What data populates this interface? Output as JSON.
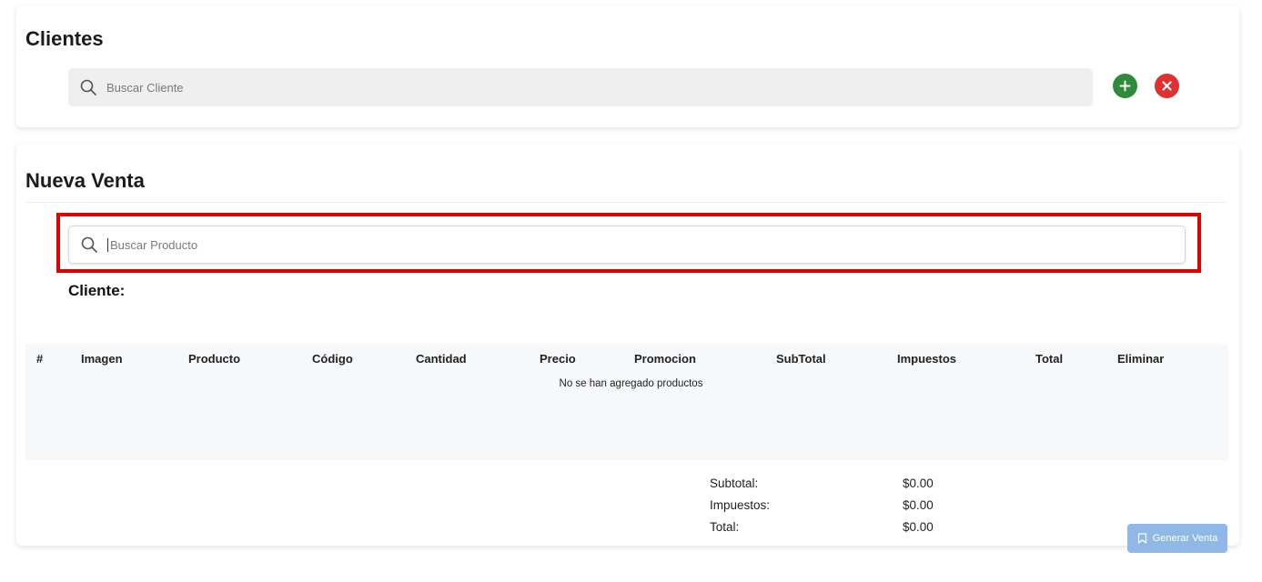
{
  "clientes": {
    "title": "Clientes",
    "search_placeholder": "Buscar Cliente",
    "add_color": "#2e8b3a",
    "remove_color": "#e03030"
  },
  "venta": {
    "title": "Nueva Venta",
    "search_placeholder": "Buscar Producto",
    "cliente_label": "Cliente:"
  },
  "table": {
    "columns": [
      "#",
      "Imagen",
      "Producto",
      "Código",
      "Cantidad",
      "Precio",
      "Promocion",
      "SubTotal",
      "Impuestos",
      "Total",
      "Eliminar"
    ],
    "empty_message": "No se han agregado productos"
  },
  "totals": {
    "subtotal_label": "Subtotal:",
    "subtotal_value": "$0.00",
    "impuestos_label": "Impuestos:",
    "impuestos_value": "$0.00",
    "total_label": "Total:",
    "total_value": "$0.00"
  },
  "generate_button": {
    "label": "Generar Venta",
    "icon": "bookmark-icon",
    "color": "#8fb8e6"
  },
  "highlight_color": "#e00000"
}
